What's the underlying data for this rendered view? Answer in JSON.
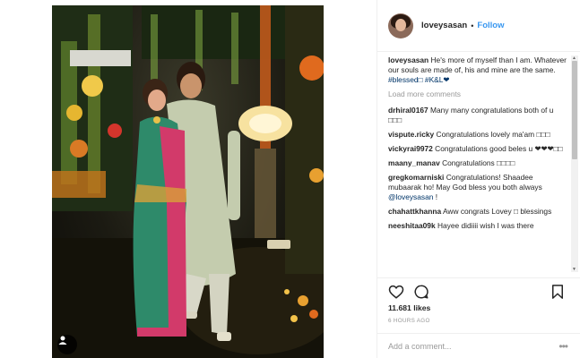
{
  "post": {
    "username": "loveysasan",
    "follow_label": "Follow",
    "separator": "•",
    "caption": {
      "user": "loveysasan",
      "text": "He's more of myself than I am. Whatever our souls are made of, his and mine are the same.",
      "tags": "#blessed□ #K&L❤"
    },
    "load_more_label": "Load more comments",
    "comments": [
      {
        "user": "drhiral0167",
        "text": "Many many congratulations both of u □□□"
      },
      {
        "user": "vispute.ricky",
        "text": "Congratulations lovely ma'am □□□"
      },
      {
        "user": "vickyrai9972",
        "text": "Congratulations good beles u ❤❤❤□□"
      },
      {
        "user": "maany_manav",
        "text": "Congratulations □□□□"
      },
      {
        "user": "gregkomarniski",
        "text": "Congratulations! Shaadee mubaarak ho! May God bless you both always",
        "mention": "@loveysasan",
        "suffix": " !"
      },
      {
        "user": "chahattkhanna",
        "text": "Aww congrats Lovey □ blessings"
      },
      {
        "user": "neeshitaa09k",
        "text": "Hayee didiiii wish I was there"
      }
    ],
    "likes": "11.681 likes",
    "time": "6 HOURS AGO",
    "add_comment_placeholder": "Add a comment...",
    "more_label": "•••"
  },
  "icons": {
    "like": "heart-icon",
    "comment": "comment-icon",
    "save": "bookmark-icon",
    "tag": "user-tag-icon"
  },
  "colors": {
    "link_blue": "#3897f0",
    "text": "#262626",
    "muted": "#999999",
    "border": "#efefef"
  }
}
